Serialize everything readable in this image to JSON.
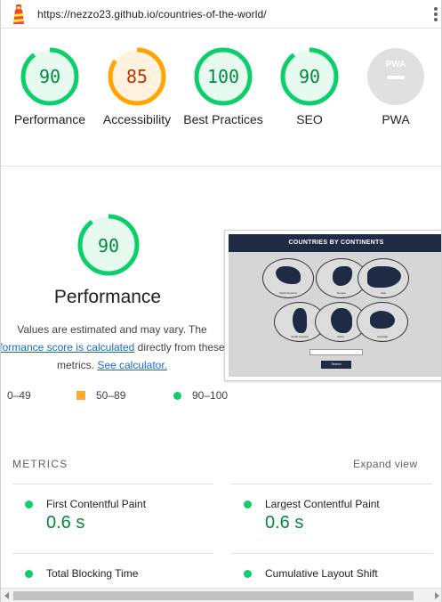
{
  "topbar": {
    "url": "https://nezzo23.github.io/countries-of-the-world/",
    "logo_icon": "lighthouse-icon",
    "menu_icon": "kebab-menu-icon"
  },
  "gauges": [
    {
      "score": "90",
      "label": "Performance",
      "status": "pass"
    },
    {
      "score": "85",
      "label": "Accessibility",
      "status": "average"
    },
    {
      "score": "100",
      "label": "Best Practices",
      "status": "pass"
    },
    {
      "score": "90",
      "label": "SEO",
      "status": "pass"
    },
    {
      "score": "",
      "label": "PWA",
      "status": "na",
      "badge": "PWA"
    }
  ],
  "performance": {
    "score": "90",
    "title": "Performance",
    "desc_before": "Values are estimated and may vary. The ",
    "desc_link": "formance score is calculated",
    "desc_middle": " directly from these",
    "desc_end": "metrics.",
    "calc_link": "See calculator."
  },
  "legend": {
    "fail": "0–49",
    "average": "50–89",
    "pass": "90–100"
  },
  "screenshot": {
    "header": "COUNTRIES BY CONTINENTS",
    "continents": [
      "North America",
      "Europe",
      "Asia",
      "South America",
      "Africa",
      "Australia"
    ],
    "button": "Search"
  },
  "metrics": {
    "heading": "METRICS",
    "expand": "Expand view",
    "items": [
      {
        "name": "First Contentful Paint",
        "value": "0.6 s"
      },
      {
        "name": "Largest Contentful Paint",
        "value": "0.6 s"
      },
      {
        "name": "Total Blocking Time",
        "value": ""
      },
      {
        "name": "Cumulative Layout Shift",
        "value": ""
      }
    ]
  },
  "colors": {
    "pass": "#0cce6b",
    "pass_text": "#008a41",
    "average": "#ffa400",
    "average_text": "#c33300",
    "na": "#cfcfcf",
    "link": "#1967d2"
  }
}
